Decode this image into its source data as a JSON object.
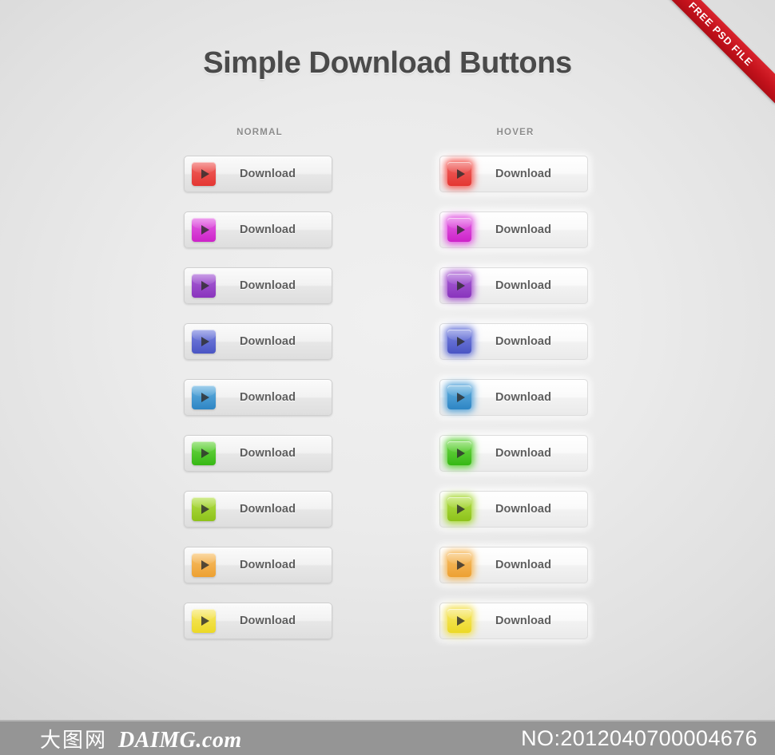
{
  "page": {
    "title": "Simple Download Buttons",
    "background_color": "#e9e9e9"
  },
  "ribbon": {
    "label": "FREE PSD FILE",
    "color": "#c4121c"
  },
  "columns": [
    {
      "key": "normal",
      "header": "NORMAL",
      "state": "normal"
    },
    {
      "key": "hover",
      "header": "HOVER",
      "state": "hover"
    }
  ],
  "button_label": "Download",
  "buttons": [
    {
      "name": "red",
      "label": "Download",
      "icon": "play-icon",
      "color_top": "#f06461",
      "color_bottom": "#e43632",
      "glow": "#f4554f"
    },
    {
      "name": "magenta",
      "label": "Download",
      "icon": "play-icon",
      "color_top": "#e364e4",
      "color_bottom": "#cd22c9",
      "glow": "#e04fe0"
    },
    {
      "name": "purple",
      "label": "Download",
      "icon": "play-icon",
      "color_top": "#a861d6",
      "color_bottom": "#8a34bd",
      "glow": "#a14ccd"
    },
    {
      "name": "indigo",
      "label": "Download",
      "icon": "play-icon",
      "color_top": "#7b85e0",
      "color_bottom": "#4a55c4",
      "glow": "#6370d8"
    },
    {
      "name": "blue",
      "label": "Download",
      "icon": "play-icon",
      "color_top": "#66b2e0",
      "color_bottom": "#2d85c4",
      "glow": "#4fa0d8"
    },
    {
      "name": "green",
      "label": "Download",
      "icon": "play-icon",
      "color_top": "#72d84a",
      "color_bottom": "#36b814",
      "glow": "#5ad032"
    },
    {
      "name": "lime",
      "label": "Download",
      "icon": "play-icon",
      "color_top": "#b4e04a",
      "color_bottom": "#8dc21a",
      "glow": "#a6d832"
    },
    {
      "name": "orange",
      "label": "Download",
      "icon": "play-icon",
      "color_top": "#f7c06a",
      "color_bottom": "#eda031",
      "glow": "#f5b44f"
    },
    {
      "name": "yellow",
      "label": "Download",
      "icon": "play-icon",
      "color_top": "#f7e86a",
      "color_bottom": "#ecd926",
      "glow": "#f3e04a"
    }
  ],
  "footer": {
    "brand_cn": "大图网",
    "brand_en": "DAIMG.com",
    "serial": "NO:2012040700004676"
  }
}
